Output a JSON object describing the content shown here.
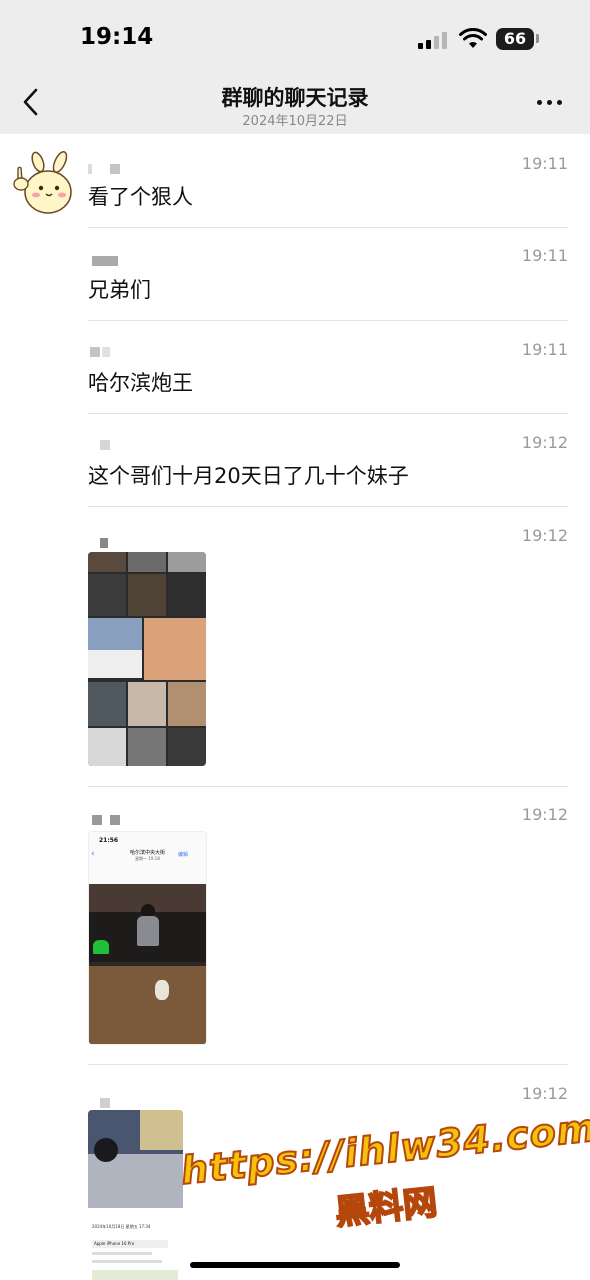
{
  "status_bar": {
    "time": "19:14",
    "battery": "66"
  },
  "nav": {
    "title": "群聊的聊天记录",
    "subtitle": "2024年10月22日",
    "back_icon": "chevron-left-icon",
    "more_icon": "more-dots-icon"
  },
  "messages": [
    {
      "time": "19:11",
      "text": "看了个狠人"
    },
    {
      "time": "19:11",
      "text": "兄弟们"
    },
    {
      "time": "19:11",
      "text": "哈尔滨炮王"
    },
    {
      "time": "19:12",
      "text": "这个哥们十月20天日了几十个妹子"
    },
    {
      "time": "19:12",
      "image": "photo-collage"
    },
    {
      "time": "19:12",
      "image": "phone-screenshot",
      "screenshot": {
        "time": "21:56",
        "title": "哈尔滨中央大街",
        "subtitle": "星期一 19:18",
        "edit": "编辑"
      }
    },
    {
      "time": "19:12",
      "image": "photo-with-info",
      "info": {
        "date": "2024年10月18日 星期五 17:34",
        "device": "Apple iPhone 16 Pro"
      }
    }
  ],
  "watermark": {
    "url": "https://ihlw34.com",
    "name": "黑料网"
  },
  "colors": {
    "bar_bg": "#ededed",
    "time_gray": "#9a9a9a",
    "divider": "#e3e3e3",
    "watermark_fill": "#f4c20d",
    "watermark_stroke": "#b5470c"
  }
}
